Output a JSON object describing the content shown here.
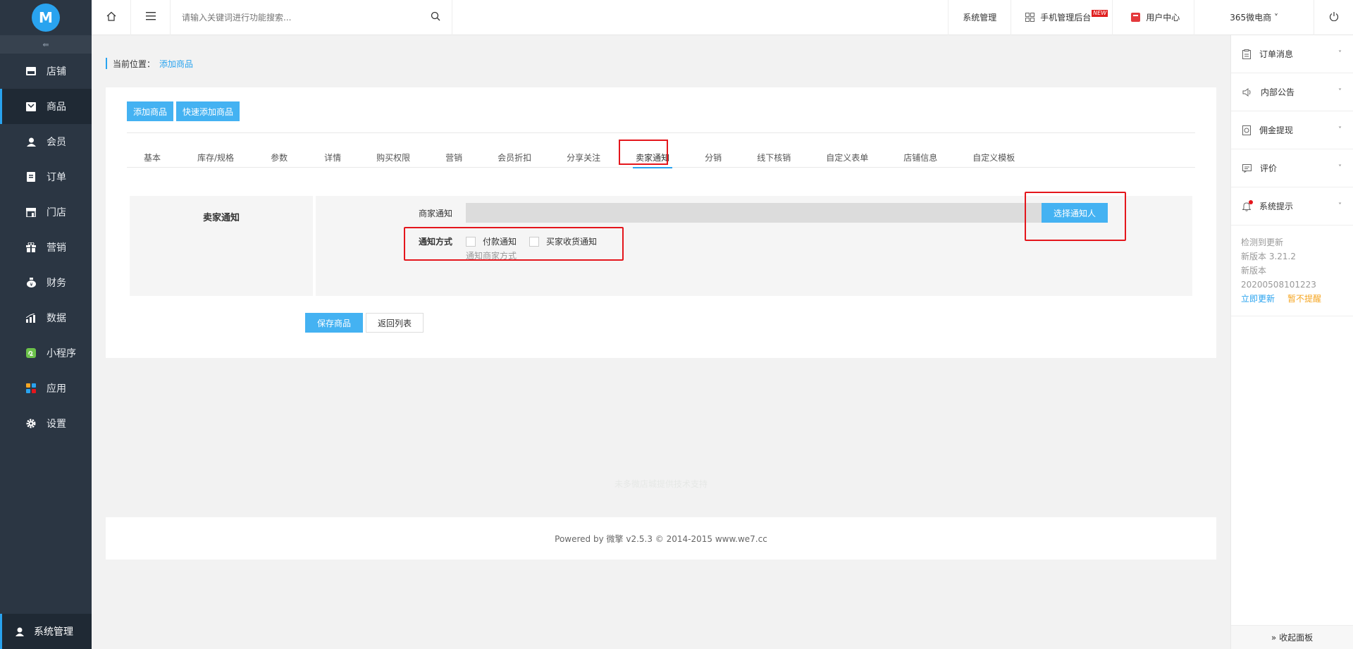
{
  "sidebar": {
    "items": [
      {
        "label": "店铺",
        "icon": "store-icon"
      },
      {
        "label": "商品",
        "icon": "goods-icon"
      },
      {
        "label": "会员",
        "icon": "member-icon"
      },
      {
        "label": "订单",
        "icon": "order-icon"
      },
      {
        "label": "门店",
        "icon": "shop-icon"
      },
      {
        "label": "营销",
        "icon": "gift-icon"
      },
      {
        "label": "财务",
        "icon": "money-bag-icon"
      },
      {
        "label": "数据",
        "icon": "chart-icon"
      },
      {
        "label": "小程序",
        "icon": "mini-program-icon"
      },
      {
        "label": "应用",
        "icon": "apps-icon"
      },
      {
        "label": "设置",
        "icon": "gear-icon"
      }
    ],
    "active": "商品",
    "bottom_label": "系统管理",
    "collapse_symbol": "⇚"
  },
  "topbar": {
    "search_placeholder": "请输入关键词进行功能搜索...",
    "links": {
      "system": "系统管理",
      "mobile": "手机管理后台",
      "new_badge": "NEW",
      "user_center": "用户中心",
      "shop": "365微电商 ˅"
    }
  },
  "breadcrumb": {
    "prefix": "当前位置：",
    "current": "添加商品"
  },
  "buttons": {
    "add": "添加商品",
    "quick_add": "快速添加商品",
    "select_notifier": "选择通知人",
    "save": "保存商品",
    "back": "返回列表"
  },
  "tabs": [
    "基本",
    "库存/规格",
    "参数",
    "详情",
    "购买权限",
    "营销",
    "会员折扣",
    "分享关注",
    "卖家通知",
    "分销",
    "线下核销",
    "自定义表单",
    "店铺信息",
    "自定义模板"
  ],
  "active_tab": "卖家通知",
  "panel": {
    "title": "卖家通知",
    "merchant_label": "商家通知",
    "method_label": "通知方式",
    "options": [
      "付款通知",
      "买家收货通知"
    ],
    "hint": "通知商家方式"
  },
  "support_text": "未多微店城提供技术支持",
  "footer": "Powered by 微擎 v2.5.3 © 2014-2015 www.we7.cc",
  "right_panel": {
    "items": [
      {
        "label": "订单消息",
        "icon": "clipboard-icon"
      },
      {
        "label": "内部公告",
        "icon": "speaker-icon"
      },
      {
        "label": "佣金提现",
        "icon": "withdraw-icon"
      },
      {
        "label": "评价",
        "icon": "comment-icon"
      },
      {
        "label": "系统提示",
        "icon": "bell-icon"
      }
    ],
    "update": {
      "detected": "检测到更新",
      "version1": "新版本 3.21.2",
      "version2": "新版本 20200508101223",
      "update_now": "立即更新",
      "later": "暂不提醒"
    },
    "collapse": "» 收起面板"
  },
  "colors": {
    "accent": "#29a3ef",
    "button": "#44b2f2",
    "sidebar": "#2b3643",
    "highlight": "#e4161c"
  }
}
